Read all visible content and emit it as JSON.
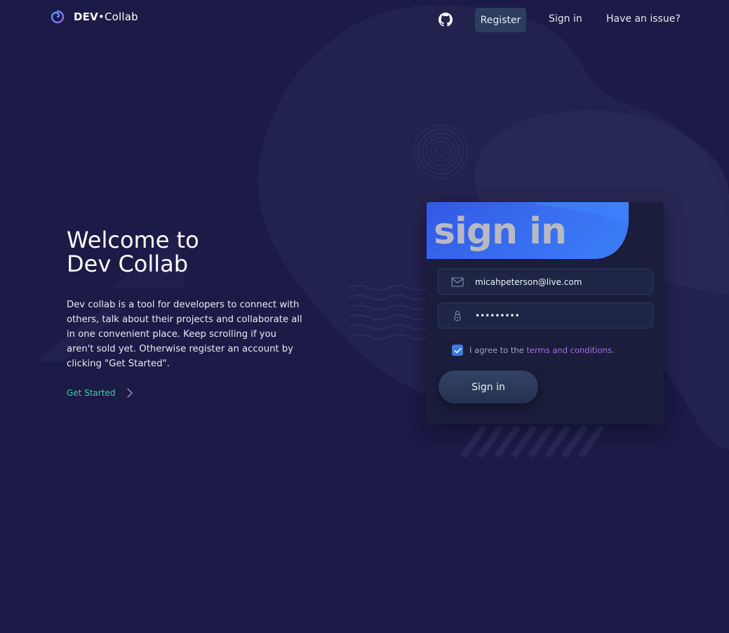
{
  "brand": {
    "name_bold": "DEV",
    "separator": "•",
    "name_rest": "Collab",
    "logo_icon": "spiral-logo-icon"
  },
  "nav": {
    "github_icon": "github-icon",
    "register_label": "Register",
    "signin_label": "Sign in",
    "issue_label": "Have an issue?"
  },
  "hero": {
    "title_line1": "Welcome to",
    "title_line2": "Dev Collab",
    "description": "Dev collab is a tool for developers to connect with others, talk about their projects and collaborate all in one convenient place. Keep scrolling if you aren't sold yet. Otherwise register an account by clicking \"Get Started\".",
    "cta_label": "Get Started",
    "cta_icon": "chevron-right-icon"
  },
  "signin_card": {
    "title": "sign in",
    "email": {
      "value": "micahpeterson@live.com",
      "icon": "mail-icon"
    },
    "password": {
      "value": "•••••••••",
      "icon": "lock-icon"
    },
    "agree": {
      "checked": true,
      "prefix": "I agree to the ",
      "link": "terms and conditions",
      "suffix": "."
    },
    "submit_label": "Sign in"
  },
  "colors": {
    "background": "#1c1a46",
    "accent_blue": "#3a6ef2",
    "cta_teal": "#2fd4b3",
    "link_purple": "#a96de8",
    "card_bg": "#1a1d3b"
  }
}
